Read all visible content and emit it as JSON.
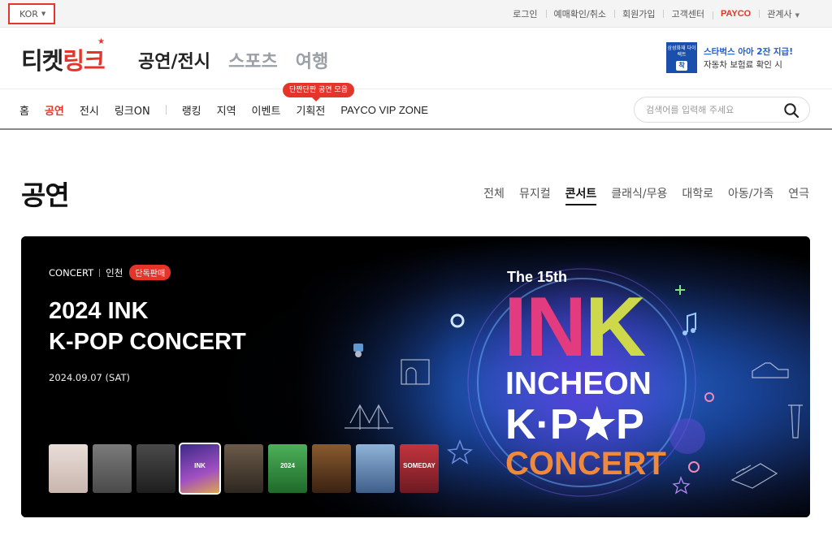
{
  "util_bar": {
    "language": "KOR",
    "links": [
      "로그인",
      "예매확인/취소",
      "회원가입",
      "고객센터",
      "PAYCO",
      "관계사"
    ]
  },
  "header": {
    "logo_black": "티켓",
    "logo_red": "링크",
    "main_tabs": [
      "공연/전시",
      "스포츠",
      "여행"
    ],
    "ad": {
      "card_text": "삼성화재 다이렉트",
      "card_mark": "착",
      "line1": "스타벅스 아아 2잔 지급!",
      "line2": "자동차 보험료 확인 시"
    }
  },
  "nav": {
    "items": [
      "홈",
      "공연",
      "전시",
      "링크ON"
    ],
    "items2": [
      "랭킹",
      "지역",
      "이벤트",
      "기획전",
      "PAYCO VIP ZONE"
    ],
    "active": "공연",
    "tooltip": "단짠단짠 공연 모음",
    "search_placeholder": "검색어를 입력해 주세요"
  },
  "section": {
    "title": "공연",
    "categories": [
      "전체",
      "뮤지컬",
      "콘서트",
      "클래식/무용",
      "대학로",
      "아동/가족",
      "연극"
    ],
    "active_category": "콘서트"
  },
  "hero": {
    "category": "CONCERT",
    "region": "인천",
    "badge": "단독판매",
    "title_line1": "2024 INK",
    "title_line2": "K-POP CONCERT",
    "date": "2024.09.07 (SAT)",
    "poster": {
      "line1": "The 15th",
      "line2": "INK",
      "line3": "INCHEON",
      "line4": "K·P★P",
      "line5": "CONCERT"
    },
    "thumbnails": [
      {
        "label": "",
        "color": "#d9c9c4"
      },
      {
        "label": "",
        "color": "#6e6e6e"
      },
      {
        "label": "",
        "color": "#3a3a3a"
      },
      {
        "label": "INK",
        "color": "#7b3fb0"
      },
      {
        "label": "",
        "color": "#5a4a3a"
      },
      {
        "label": "2024",
        "color": "#2f8a3a"
      },
      {
        "label": "",
        "color": "#6a3a1e"
      },
      {
        "label": "",
        "color": "#4f6d9a"
      },
      {
        "label": "SOMEDAY",
        "color": "#b0323a"
      }
    ]
  },
  "colors": {
    "accent": "#e5352b",
    "link_blue": "#1b5bd6"
  }
}
